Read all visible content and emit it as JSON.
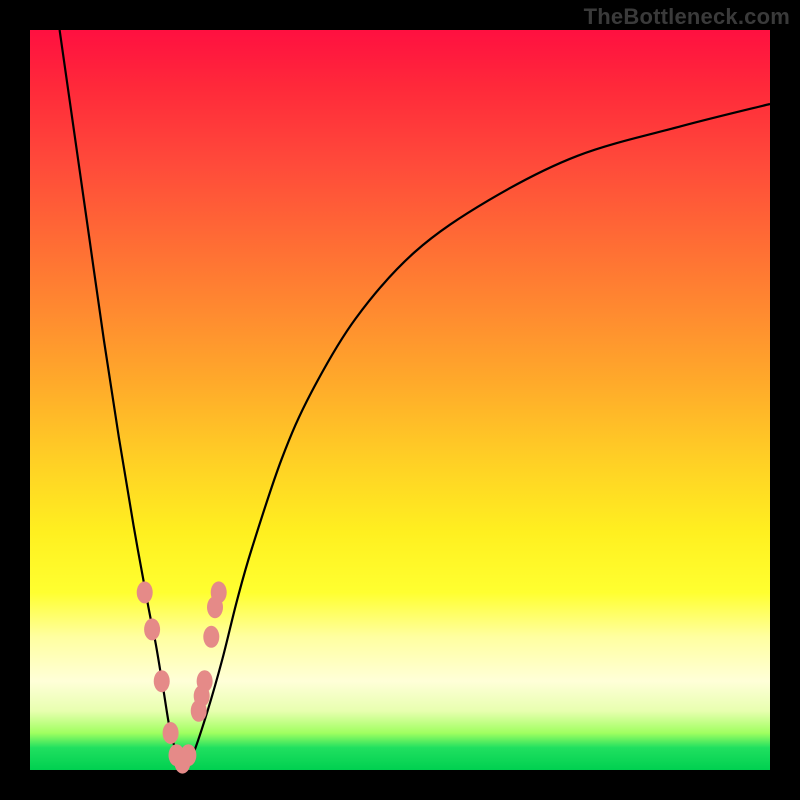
{
  "watermark": "TheBottleneck.com",
  "chart_data": {
    "type": "line",
    "title": "",
    "xlabel": "",
    "ylabel": "",
    "xlim": [
      0,
      100
    ],
    "ylim": [
      0,
      100
    ],
    "grid": false,
    "series": [
      {
        "name": "curve",
        "x": [
          4,
          6,
          8,
          10,
          12,
          14,
          16,
          17,
          18,
          19,
          20,
          21,
          22,
          24,
          26,
          28,
          30,
          34,
          38,
          44,
          52,
          62,
          74,
          88,
          100
        ],
        "values": [
          100,
          86,
          72,
          58,
          45,
          33,
          22,
          17,
          11,
          5,
          2,
          0,
          2,
          8,
          15,
          23,
          30,
          42,
          51,
          61,
          70,
          77,
          83,
          87,
          90
        ]
      }
    ],
    "markers": {
      "name": "highlighted-points",
      "color": "#e58a88",
      "x": [
        15.5,
        16.5,
        17.8,
        19.0,
        19.8,
        20.6,
        21.4,
        22.8,
        23.2,
        23.6,
        24.5,
        25.0,
        25.5
      ],
      "values": [
        24.0,
        19.0,
        12.0,
        5.0,
        2.0,
        1.0,
        2.0,
        8.0,
        10.0,
        12.0,
        18.0,
        22.0,
        24.0
      ]
    }
  }
}
